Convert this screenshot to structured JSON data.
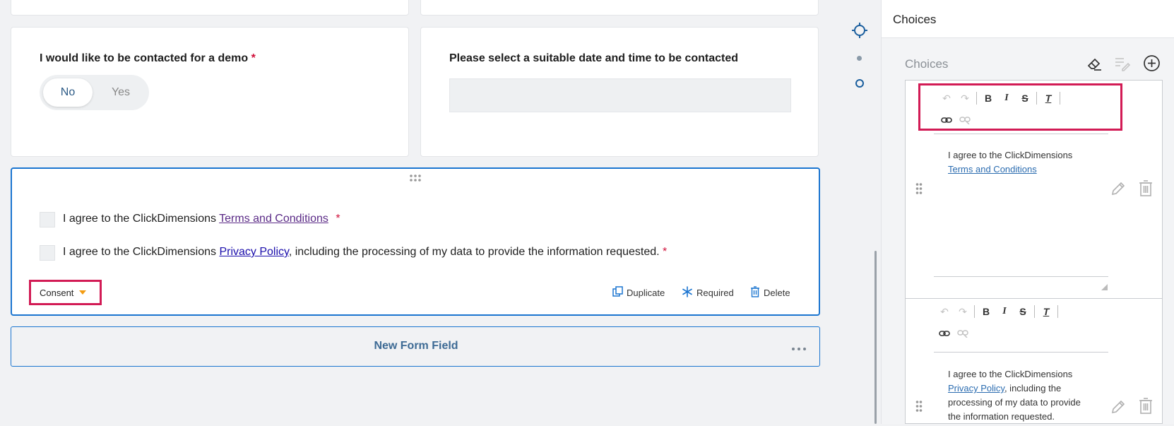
{
  "form": {
    "demo": {
      "label": "I would like to be contacted for a demo",
      "required_mark": "*",
      "toggle_on": "No",
      "toggle_off": "Yes"
    },
    "date": {
      "label": "Please select a suitable date and time to be contacted"
    },
    "consent": {
      "item1_prefix": "I agree to the ClickDimensions",
      "item1_link": "Terms and Conditions",
      "item1_req": "*",
      "item2_prefix": "I agree to the ClickDimensions",
      "item2_link": "Privacy Policy",
      "item2_suffix": ", including the processing of my data to provide the information requested.",
      "item2_req": "*",
      "type_label": "Consent",
      "duplicate": "Duplicate",
      "required": "Required",
      "delete": "Delete"
    },
    "new_field": "New Form Field"
  },
  "panel": {
    "header": "Choices",
    "section_label": "Choices",
    "choice1": {
      "line1": "I agree to the ClickDimensions",
      "link": "Terms and Conditions"
    },
    "choice2": {
      "line1": "I agree to the ClickDimensions",
      "link": "Privacy Policy",
      "line2": ", including the",
      "line3": "processing of my data to provide",
      "line4": "the information requested."
    }
  },
  "toolbar": {
    "bold": "B",
    "italic": "I",
    "strike": "S",
    "clear": "T"
  },
  "colors": {
    "accent": "#1b75d0",
    "highlight": "#d21b55",
    "required": "#d0103a",
    "orange": "#f39c12"
  }
}
